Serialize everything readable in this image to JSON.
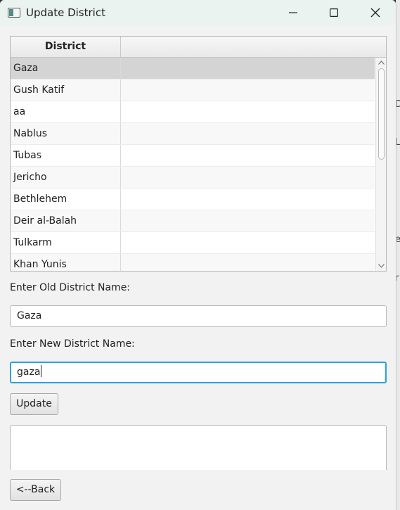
{
  "window": {
    "title": "Update District"
  },
  "table": {
    "columns": [
      "District",
      ""
    ],
    "rows": [
      "Gaza",
      "Gush Katif",
      "aa",
      "Nablus",
      "Tubas",
      "Jericho",
      "Bethlehem",
      "Deir al-Balah",
      "Tulkarm",
      "Khan Yunis"
    ],
    "selected_index": 0
  },
  "form": {
    "old_label": "Enter Old District Name:",
    "old_value": "Gaza",
    "new_label": "Enter New District Name:",
    "new_value": "gaza",
    "update_button": "Update",
    "back_button": "<--Back"
  },
  "background_fragments": [
    "D",
    "L",
    "e",
    "r"
  ],
  "colors": {
    "focus_border": "#2aa3d9",
    "selected_row": "#d4d4d4",
    "titlebar": "#eaf3f0"
  },
  "icons": [
    "app-window-icon",
    "minimize-icon",
    "maximize-icon",
    "close-icon",
    "scroll-up-icon",
    "scroll-down-icon"
  ]
}
